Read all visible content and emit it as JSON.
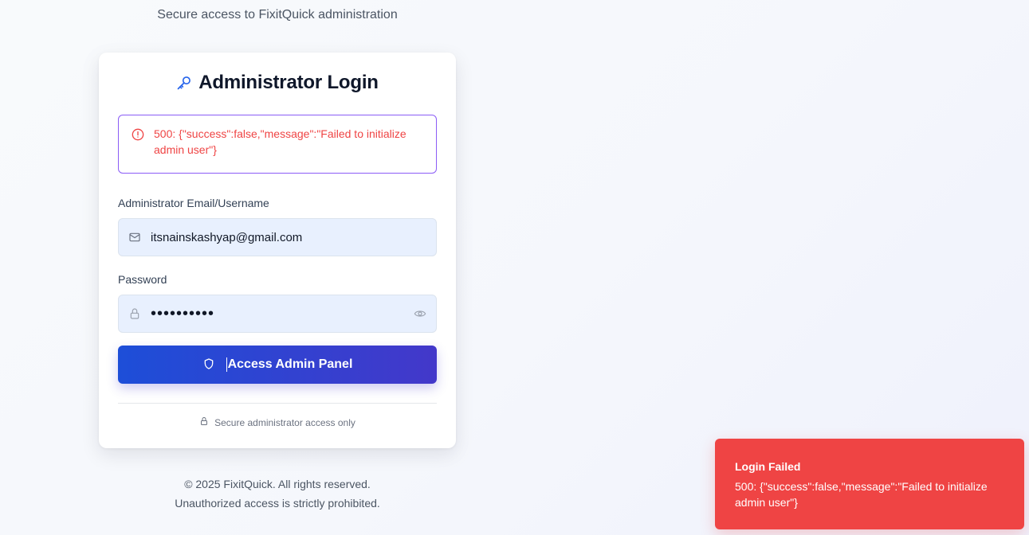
{
  "page": {
    "subtitle": "Secure access to FixitQuick administration"
  },
  "login_card": {
    "title": "Administrator Login",
    "title_icon": "key-icon",
    "error": {
      "icon": "alert-circle-icon",
      "message": "500: {\"success\":false,\"message\":\"Failed to initialize admin user\"}"
    },
    "email_field": {
      "label": "Administrator Email/Username",
      "icon": "mail-icon",
      "value": "itsnainskashyap@gmail.com"
    },
    "password_field": {
      "label": "Password",
      "icon": "lock-icon",
      "value": "••••••••••",
      "toggle_icon": "eye-icon"
    },
    "submit": {
      "label": "Access Admin Panel",
      "icon": "shield-icon"
    },
    "secure_note": {
      "icon": "lock-icon",
      "text": "Secure administrator access only"
    }
  },
  "footer": {
    "copyright": "© 2025 FixitQuick. All rights reserved.",
    "warning": "Unauthorized access is strictly prohibited."
  },
  "toast": {
    "title": "Login Failed",
    "message": "500: {\"success\":false,\"message\":\"Failed to initialize admin user\"}"
  },
  "colors": {
    "error_red": "#ef4444",
    "alert_border": "#8b5cf6",
    "button_gradient_start": "#1d4ed8",
    "button_gradient_end": "#4338ca",
    "input_bg": "#e8f0fe",
    "key_icon": "#2563eb"
  }
}
